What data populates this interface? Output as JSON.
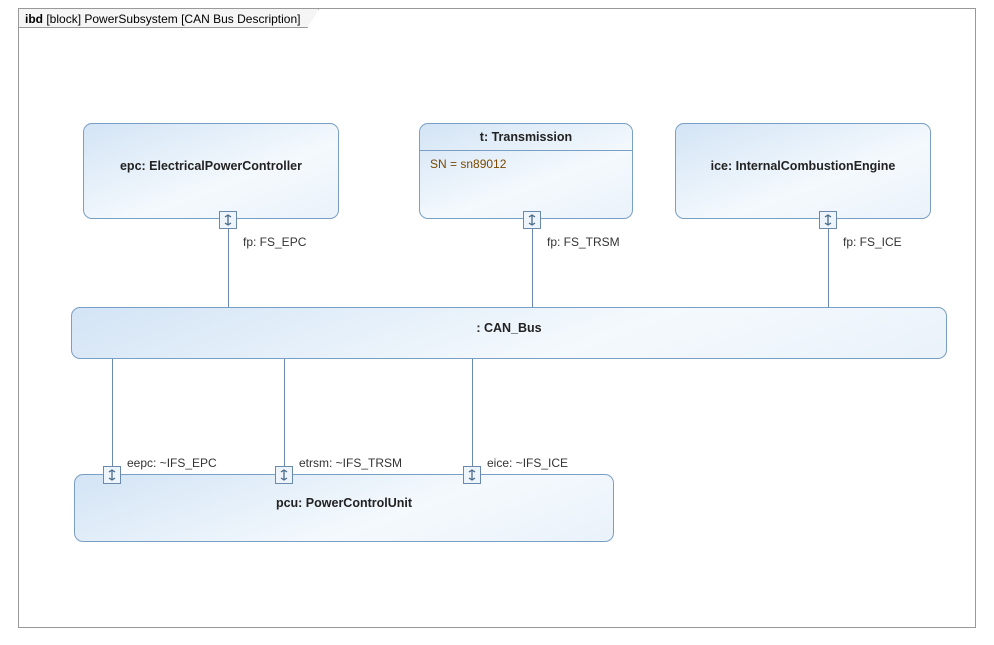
{
  "frame": {
    "kind": "ibd",
    "context": "[block]",
    "name": "PowerSubsystem",
    "diagram_name": "[CAN Bus Description]"
  },
  "blocks": {
    "epc": {
      "label": "epc: ElectricalPowerController"
    },
    "t": {
      "label": "t: Transmission",
      "attr": "SN = sn89012"
    },
    "ice": {
      "label": "ice: InternalCombustionEngine"
    },
    "canbus": {
      "label": ": CAN_Bus"
    },
    "pcu": {
      "label": "pcu: PowerControlUnit"
    }
  },
  "ports": {
    "epc_fp": "fp: FS_EPC",
    "t_fp": "fp: FS_TRSM",
    "ice_fp": "fp: FS_ICE",
    "pcu_eepc": "eepc: ~IFS_EPC",
    "pcu_etrsm": "etrsm: ~IFS_TRSM",
    "pcu_eice": "eice: ~IFS_ICE"
  }
}
